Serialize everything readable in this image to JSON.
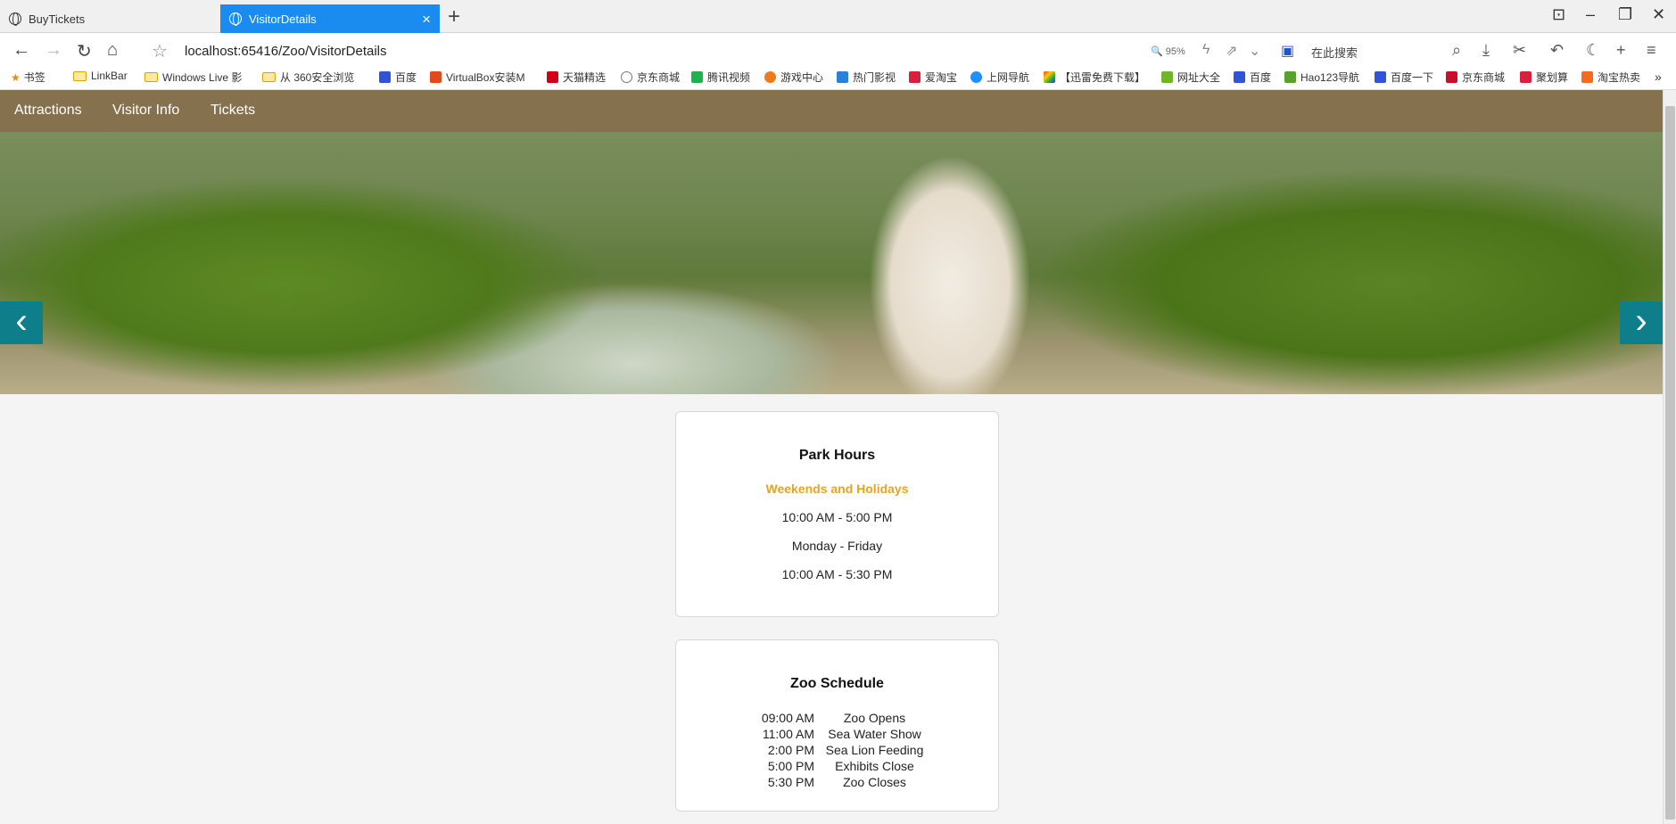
{
  "browser": {
    "tabs": [
      {
        "title": "BuyTickets",
        "active": false
      },
      {
        "title": "VisitorDetails",
        "active": true
      }
    ],
    "url": "localhost:65416/Zoo/VisitorDetails",
    "zoom": "95%",
    "search_placeholder": "在此搜索",
    "bookmarks": [
      "书签",
      "LinkBar",
      "Windows Live 影",
      "从 360安全浏览",
      "百度",
      "VirtualBox安装M",
      "天猫精选",
      "京东商城",
      "腾讯视频",
      "游戏中心",
      "热门影视",
      "爱淘宝",
      "上网导航",
      "【迅雷免费下载】",
      "网址大全",
      "百度",
      "Hao123导航",
      "百度一下",
      "京东商城",
      "聚划算",
      "淘宝热卖"
    ]
  },
  "nav": {
    "items": [
      "Attractions",
      "Visitor Info",
      "Tickets"
    ]
  },
  "hero": {
    "prev_label": "‹",
    "next_label": "›"
  },
  "park_hours": {
    "title": "Park Hours",
    "subtitle": "Weekends and Holidays",
    "weekend_hours": "10:00 AM - 5:00 PM",
    "weekday_label": "Monday - Friday",
    "weekday_hours": "10:00 AM - 5:30 PM"
  },
  "schedule": {
    "title": "Zoo Schedule",
    "rows": [
      {
        "time": "09:00 AM",
        "event": "Zoo Opens"
      },
      {
        "time": "11:00 AM",
        "event": "Sea Water Show"
      },
      {
        "time": "2:00 PM",
        "event": "Sea Lion Feeding"
      },
      {
        "time": "5:00 PM",
        "event": "Exhibits Close"
      },
      {
        "time": "5:30 PM",
        "event": "Zoo Closes"
      }
    ]
  },
  "colors": {
    "nav_bg": "#85714d",
    "accent": "#e8a421",
    "carousel_arrow": "#0e7f8a",
    "active_tab": "#1a8cf0"
  }
}
